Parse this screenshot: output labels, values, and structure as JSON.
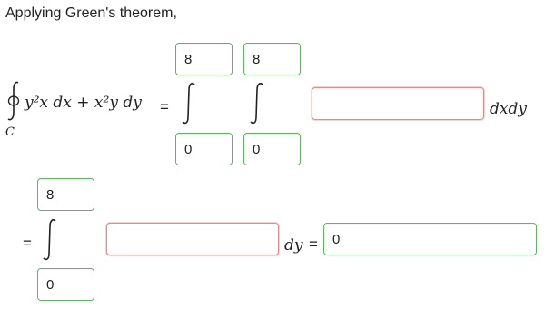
{
  "prompt": "Applying Green's theorem,",
  "line_integral": {
    "contour_label": "C",
    "expression": "y²x dx + x²y dy",
    "equals": "="
  },
  "double_integral": {
    "outer_upper": "8",
    "outer_lower": "0",
    "inner_upper": "8",
    "inner_lower": "0",
    "integrand": "",
    "differential": "dxdy"
  },
  "single_integral": {
    "equals": "=",
    "upper": "8",
    "lower": "0",
    "integrand": "",
    "differential": "dy",
    "result_equals": "=",
    "result": "0"
  },
  "colors": {
    "correct_border": "#5cb85c",
    "incorrect_border": "#e58a8a"
  },
  "icons": [
    "contour-integral-icon",
    "integral-sign-icon"
  ]
}
